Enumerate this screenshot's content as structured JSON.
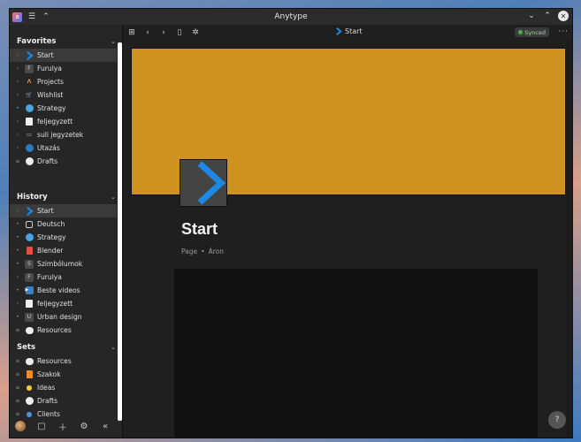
{
  "window": {
    "title": "Anytype"
  },
  "sidebar": {
    "favorites_label": "Favorites",
    "history_label": "History",
    "sets_label": "Sets",
    "favorites": [
      {
        "label": "Start",
        "icon": "start-chevron-icon",
        "expand": "arrow",
        "active": true
      },
      {
        "label": "Furulya",
        "icon": "letter-f-icon",
        "expand": "arrow"
      },
      {
        "label": "Projects",
        "icon": "projects-icon",
        "expand": "arrow"
      },
      {
        "label": "Wishlist",
        "icon": "cart-icon",
        "expand": "arrow"
      },
      {
        "label": "Strategy",
        "icon": "globe-icon",
        "expand": "dot"
      },
      {
        "label": "feljegyzett",
        "icon": "note-icon",
        "expand": "arrow"
      },
      {
        "label": "suli jegyzetek",
        "icon": "book-icon",
        "expand": "arrow"
      },
      {
        "label": "Utazás",
        "icon": "earth-icon",
        "expand": "arrow"
      },
      {
        "label": "Drafts",
        "icon": "circle-icon",
        "expand": "filter"
      }
    ],
    "history": [
      {
        "label": "Start",
        "icon": "start-chevron-icon",
        "expand": "arrow",
        "active": true
      },
      {
        "label": "Deutsch",
        "icon": "checkbox-icon",
        "expand": "dot"
      },
      {
        "label": "Strategy",
        "icon": "globe-icon",
        "expand": "dot"
      },
      {
        "label": "Blender",
        "icon": "cup-icon",
        "expand": "dot"
      },
      {
        "label": "Szimbólumok",
        "icon": "letter-s-icon",
        "expand": "dot"
      },
      {
        "label": "Furulya",
        "icon": "letter-f-icon",
        "expand": "arrow"
      },
      {
        "label": "Beste videos",
        "icon": "play-icon",
        "expand": "dot"
      },
      {
        "label": "feljegyzett",
        "icon": "note-icon",
        "expand": "arrow"
      },
      {
        "label": "Urban design",
        "icon": "letter-u-icon",
        "expand": "dot"
      },
      {
        "label": "Resources",
        "icon": "chat-icon",
        "expand": "filter"
      }
    ],
    "sets": [
      {
        "label": "Resources",
        "icon": "chat-icon",
        "expand": "filter"
      },
      {
        "label": "Szakok",
        "icon": "book-orange-icon",
        "expand": "filter"
      },
      {
        "label": "Ideas",
        "icon": "bulb-icon",
        "expand": "filter"
      },
      {
        "label": "Drafts",
        "icon": "circle-icon",
        "expand": "filter"
      },
      {
        "label": "Clients",
        "icon": "person-icon",
        "expand": "filter"
      }
    ]
  },
  "topbar": {
    "crumb": "Start",
    "status": "Synced"
  },
  "page": {
    "title": "Start",
    "type": "Page",
    "author": "Áron",
    "cover_color": "#cf921f",
    "icon_color": "#1e88e5"
  },
  "help_label": "?"
}
